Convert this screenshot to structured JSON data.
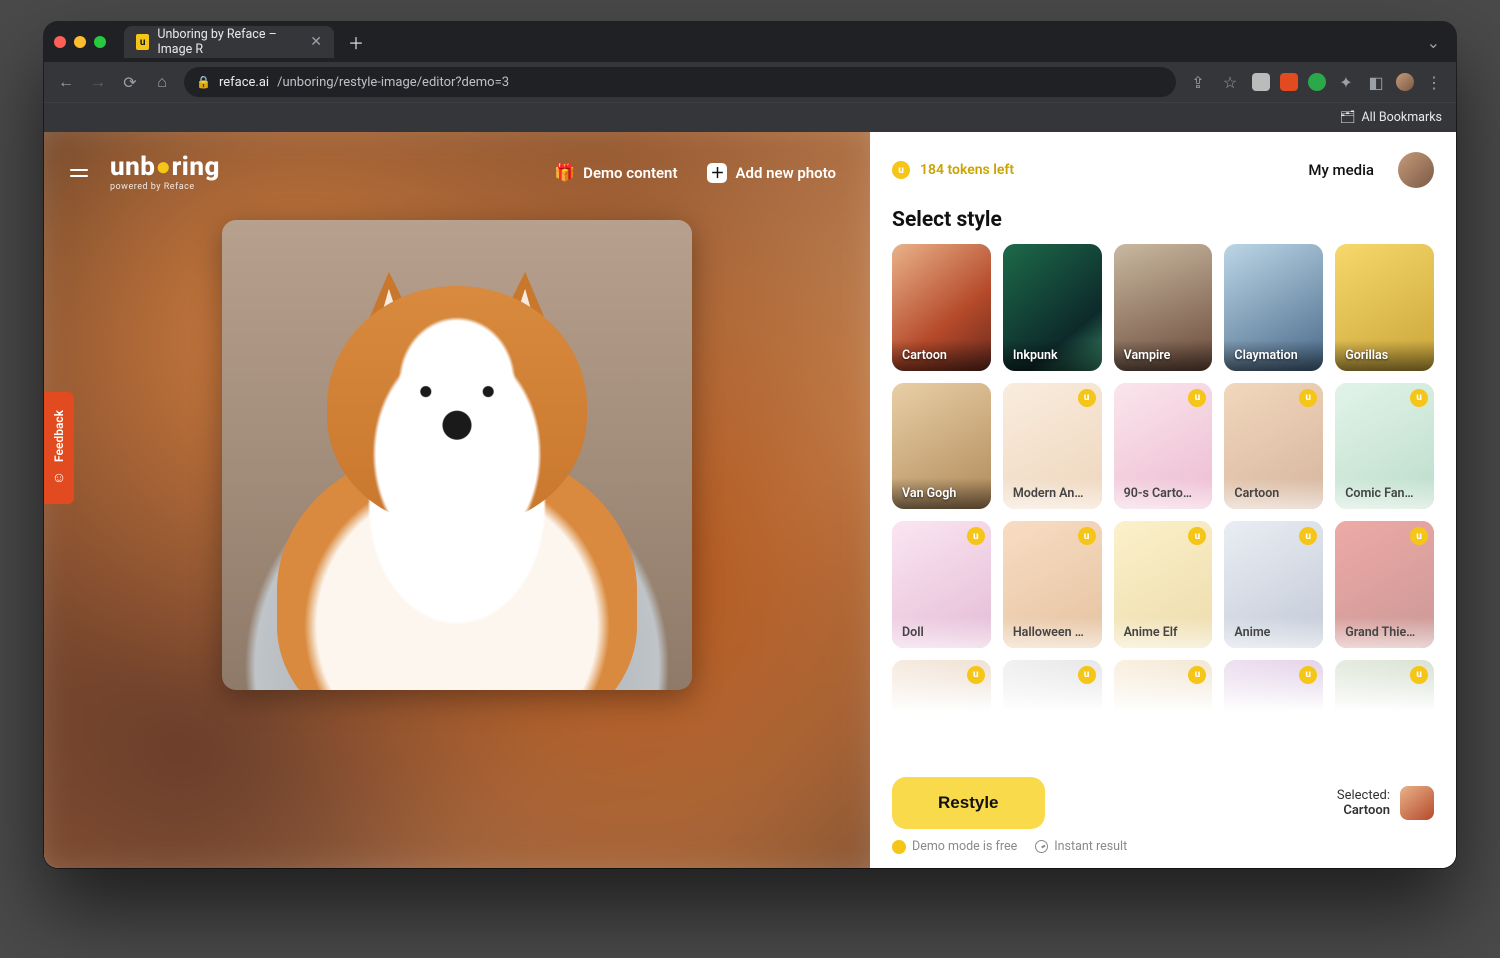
{
  "browser": {
    "tab_title": "Unboring by Reface – Image R",
    "url_host": "reface.ai",
    "url_path": "/unboring/restyle-image/editor?demo=3",
    "bookmarks_label": "All Bookmarks"
  },
  "app": {
    "logo_main": "unboring",
    "logo_sub": "powered by Reface",
    "demo_content": "Demo content",
    "add_new_photo": "Add new photo",
    "feedback": "Feedback"
  },
  "panel": {
    "tokens_text": "184 tokens left",
    "my_media": "My media",
    "heading": "Select style",
    "restyle": "Restyle",
    "selected_label": "Selected:",
    "selected_value": "Cartoon",
    "note_free": "Demo mode is free",
    "note_instant": "Instant result"
  },
  "styles": [
    {
      "label": "Cartoon",
      "locked": false,
      "selected": true
    },
    {
      "label": "Inkpunk",
      "locked": false,
      "selected": false
    },
    {
      "label": "Vampire",
      "locked": false,
      "selected": false
    },
    {
      "label": "Claymation",
      "locked": false,
      "selected": false
    },
    {
      "label": "Gorillas",
      "locked": false,
      "selected": false
    },
    {
      "label": "Van Gogh",
      "locked": false,
      "selected": false
    },
    {
      "label": "Modern An…",
      "locked": true,
      "selected": false
    },
    {
      "label": "90-s Carto…",
      "locked": true,
      "selected": false
    },
    {
      "label": "Cartoon",
      "locked": true,
      "selected": false
    },
    {
      "label": "Comic Fan…",
      "locked": true,
      "selected": false
    },
    {
      "label": "Doll",
      "locked": true,
      "selected": false
    },
    {
      "label": "Halloween …",
      "locked": true,
      "selected": false
    },
    {
      "label": "Anime Elf",
      "locked": true,
      "selected": false
    },
    {
      "label": "Anime",
      "locked": true,
      "selected": false
    },
    {
      "label": "Grand Thie…",
      "locked": true,
      "selected": false
    },
    {
      "label": "",
      "locked": true,
      "selected": false
    },
    {
      "label": "",
      "locked": true,
      "selected": false
    },
    {
      "label": "",
      "locked": true,
      "selected": false
    },
    {
      "label": "",
      "locked": true,
      "selected": false
    },
    {
      "label": "",
      "locked": true,
      "selected": false
    }
  ]
}
